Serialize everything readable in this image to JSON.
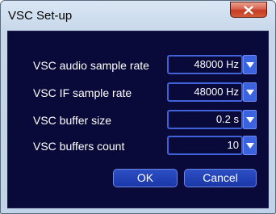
{
  "window": {
    "title": "VSC Set-up"
  },
  "settings": [
    {
      "label": "VSC audio sample rate",
      "value": "48000 Hz"
    },
    {
      "label": "VSC IF sample rate",
      "value": "48000 Hz"
    },
    {
      "label": "VSC buffer size",
      "value": "0.2 s"
    },
    {
      "label": "VSC buffers count",
      "value": "10"
    }
  ],
  "buttons": {
    "ok": "OK",
    "cancel": "Cancel"
  },
  "icons": {
    "close": "close-icon",
    "dropdown": "chevron-down-icon"
  },
  "colors": {
    "client_background": "#0a0a3a",
    "field_border": "#3f62d8",
    "button_fill": "#2448bc",
    "close_button": "#c43c24"
  }
}
